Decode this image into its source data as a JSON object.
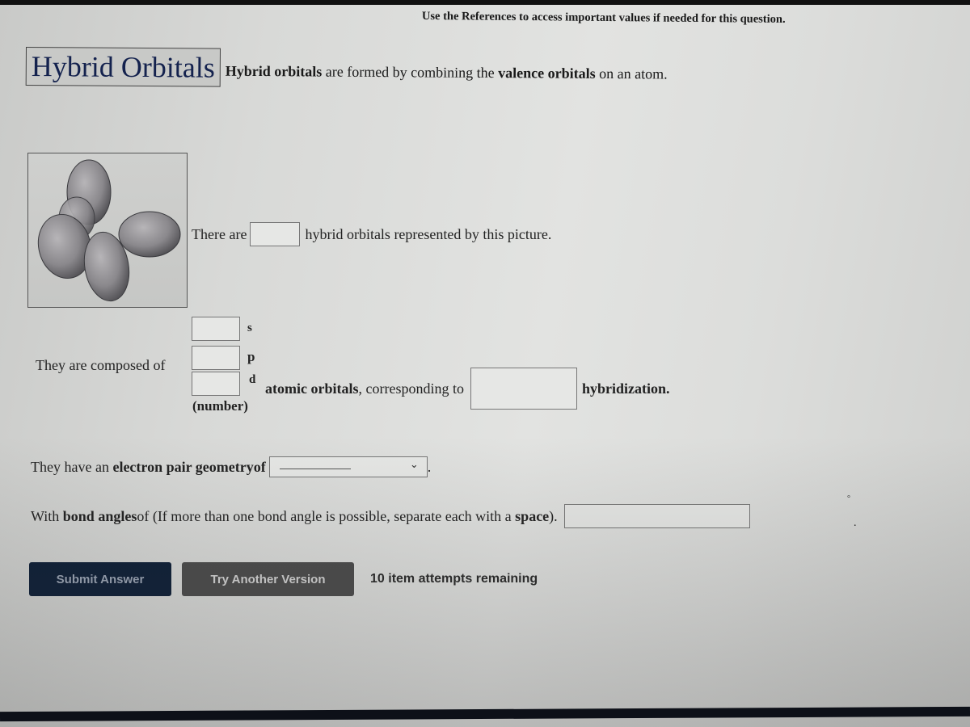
{
  "header": {
    "references_note": "Use the References to access important values if needed for this question."
  },
  "title": {
    "heading": "Hybrid Orbitals",
    "desc_parts": [
      "Hybrid orbitals",
      " are formed by combining the ",
      "valence orbitals",
      " on an atom."
    ]
  },
  "figure": {
    "icon": "hybrid-orbital-lobes-picture"
  },
  "question1": {
    "prefix": "There are",
    "value": "",
    "suffix": "hybrid orbitals represented by this picture."
  },
  "question2": {
    "prefix": "They are composed of",
    "orbitals": [
      {
        "letter": "s",
        "value": ""
      },
      {
        "letter": "p",
        "value": ""
      },
      {
        "letter": "d",
        "value": ""
      }
    ],
    "number_label": "(number)",
    "atomic_label": "atomic orbitals",
    "corresponding": ", corresponding to",
    "hybrid_value": "",
    "hybrid_suffix": "hybridization."
  },
  "question3": {
    "prefix": "They have an ",
    "bold": "electron pair geometry",
    "of": " of",
    "selected": "",
    "period": "."
  },
  "question4": {
    "prefix": "With ",
    "bold1": "bond angles",
    "middle": " of (If more than one bond angle is possible, separate each with a ",
    "bold2": "space",
    "end": ").",
    "value": "",
    "unit": "°",
    "period": "."
  },
  "actions": {
    "submit_label": "Submit Answer",
    "try_label": "Try Another Version",
    "attempts_text": "10 item attempts remaining"
  }
}
